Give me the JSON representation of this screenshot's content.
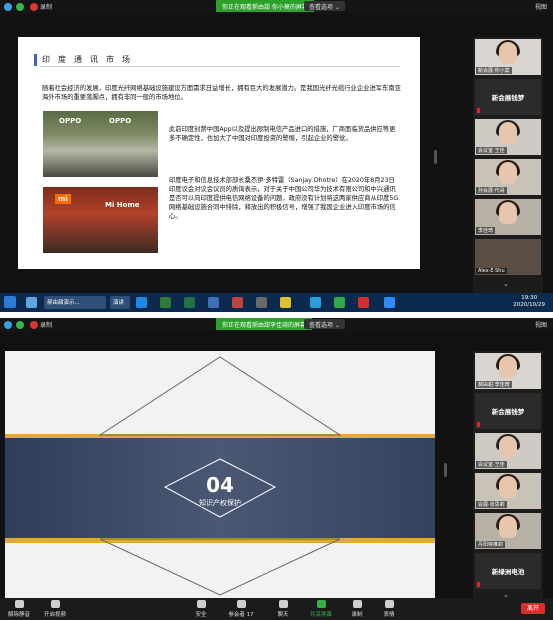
{
  "topbar": {
    "record_label": "录制",
    "share_banner": "你正在观看郝由甜 你小莫的屏幕",
    "share_banner_2": "你正在观看郝由甜李佳琦的屏幕",
    "view_options": "查看选项 ⌄",
    "view_button": "视图"
  },
  "slide1": {
    "title": "印度通讯市场",
    "intro": "随着社会经济的发展，印度光纤网络基础设施建设方面需求日益增长，拥有巨大的发展潜力。是我国光纤光缆行业企业进军东南亚海外市场的重要落脚点，拥有非同一般的市场地位。",
    "para1": "此前印度封禁中国App以及提出限制电信产品进口的措施，厂商面临货品供应等更多不确定性，也加大了中国对印度投资的警惕，引起企业的警觉。",
    "para2": "印度电子和信息技术部部长桑杰伊·多特雷（Sanjay Dhotre）在2020年8月23日印度议会对议会议员的质询表示，对于关于中国公司华为技术有限公司和中兴通讯是否可以向印度提供电信网络设备的问题，政府没有计划将这两家供应商从印度5G网络基础设施合同中排除，释放出的积极信号，增强了我国企业进入印度市场的信心。",
    "photo1_tag": "OPPO",
    "photo2_tag_logo": "mi",
    "photo2_tag": "Mi Home",
    "tools": "◁ ▷ ✎ ▭ ⊕ ⋯"
  },
  "gallery1": [
    {
      "caption": "新会展·你小莫",
      "type": "video"
    },
    {
      "caption": "",
      "big": "新会展钱梦",
      "type": "name"
    },
    {
      "caption": "会议室 王佳",
      "type": "video"
    },
    {
      "caption": "孙会展·代哥",
      "type": "video"
    },
    {
      "caption": "李佳琦",
      "type": "video"
    },
    {
      "caption": "Alex·E·Shu",
      "type": "video"
    }
  ],
  "taskbar": {
    "item1": "郝由甜演示...",
    "item2": "演讲",
    "clock_time": "19:30",
    "clock_date": "2020/10/29"
  },
  "slide2": {
    "number": "04",
    "title": "知识产权保护"
  },
  "gallery2": [
    {
      "caption": "郝由甜·李佳琦",
      "type": "video"
    },
    {
      "caption": "",
      "big": "新会展钱梦",
      "type": "name"
    },
    {
      "caption": "会议室·王佳",
      "type": "video"
    },
    {
      "caption": "会展·张思莉",
      "type": "video"
    },
    {
      "caption": "丹阳特推莉",
      "type": "video"
    },
    {
      "caption": "",
      "big": "新绿洲电池",
      "type": "name"
    }
  ],
  "zoombar": {
    "mute": "解除静音",
    "video": "开启视频",
    "security": "安全",
    "participants": "参会者",
    "participants_count": "17",
    "chat": "聊天",
    "share": "共享屏幕",
    "record": "录制",
    "reactions": "表情",
    "end": "离开"
  },
  "colors": {
    "share_banner": "#2ba02b",
    "slide1_accent": "#3a67b1",
    "slide2_band": "#3f4d6a",
    "slide2_stripe": "#e3a640",
    "end_button": "#d5312b"
  }
}
